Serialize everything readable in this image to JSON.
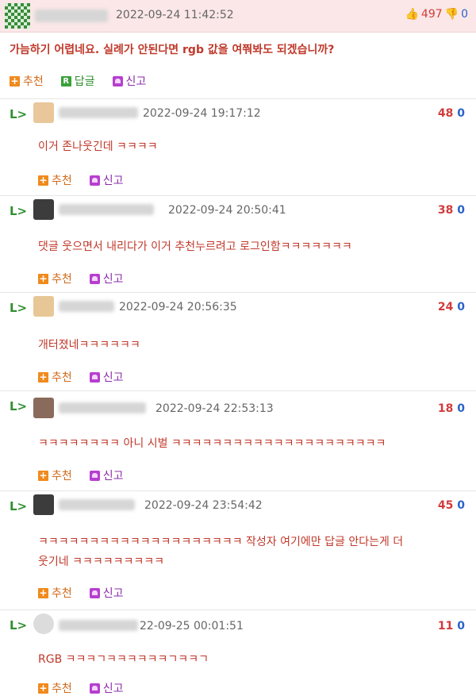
{
  "post": {
    "time": "2022-09-24 11:42:52",
    "up_count": "497",
    "down_count": "0",
    "body": "가늠하기 어렵네요. 실례가 안된다면 rgb 값을 여쭤봐도 되겠습니까?",
    "actions": {
      "recommend": "추천",
      "reply": "답글",
      "report": "신고"
    }
  },
  "comments": [
    {
      "time": "2022-09-24 19:17:12",
      "up": "48",
      "down": "0",
      "text": "이거 존나웃긴데 ㅋㅋㅋㅋ"
    },
    {
      "time": "2022-09-24 20:50:41",
      "up": "38",
      "down": "0",
      "text": "댓글 웃으면서 내리다가 이거 추천누르려고 로그인함ㅋㅋㅋㅋㅋㅋㅋ"
    },
    {
      "time": "2022-09-24 20:56:35",
      "up": "24",
      "down": "0",
      "text": "개터졌네ㅋㅋㅋㅋㅋㅋ"
    },
    {
      "time": "2022-09-24 22:53:13",
      "up": "18",
      "down": "0",
      "text": "ㅋㅋㅋㅋㅋㅋㅋㅋ 아니 시벌 ㅋㅋㅋㅋㅋㅋㅋㅋㅋㅋㅋㅋㅋㅋㅋㅋㅋㅋㅋㅋㅋ"
    },
    {
      "time": "2022-09-24 23:54:42",
      "up": "45",
      "down": "0",
      "text": "ㅋㅋㅋㅋㅋㅋㅋㅋㅋㅋㅋㅋㅋㅋㅋㅋㅋㅋㅋㅋ 작성자 여기에만 답글 안다는게 더",
      "text2": "웃기네 ㅋㅋㅋㅋㅋㅋㅋㅋㅋ"
    },
    {
      "time": "22-09-25 00:01:51",
      "up": "11",
      "down": "0",
      "text": "RGB ㅋㅋㅋㄱㅋㅋㅋㅋㅋㅋㄱㅋㅋㄱ"
    }
  ],
  "labels": {
    "recommend": "추천",
    "report": "신고",
    "reply_arrow": "L>"
  },
  "colors": {
    "accent_red": "#c0392b",
    "vote_blue": "#2a63c9",
    "header_bg": "#fbe7e7"
  }
}
